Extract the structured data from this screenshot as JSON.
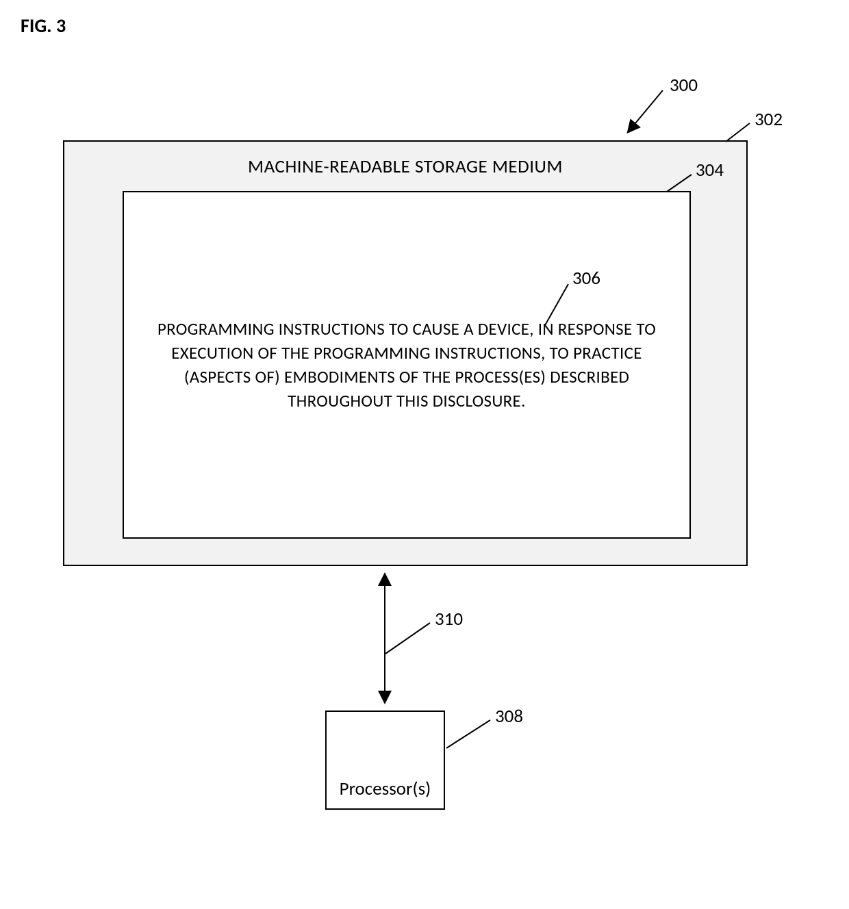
{
  "figure": {
    "label": "FIG. 3"
  },
  "outerBox": {
    "title": "MACHINE-READABLE STORAGE MEDIUM"
  },
  "innerBox": {
    "text": "PROGRAMMING INSTRUCTIONS TO CAUSE A DEVICE, IN RESPONSE TO EXECUTION OF THE PROGRAMMING INSTRUCTIONS, TO PRACTICE (ASPECTS OF) EMBODIMENTS OF THE PROCESS(ES) DESCRIBED THROUGHOUT THIS DISCLOSURE."
  },
  "processor": {
    "label": "Processor(s)"
  },
  "refs": {
    "r300": "300",
    "r302": "302",
    "r304": "304",
    "r306": "306",
    "r308": "308",
    "r310": "310"
  }
}
